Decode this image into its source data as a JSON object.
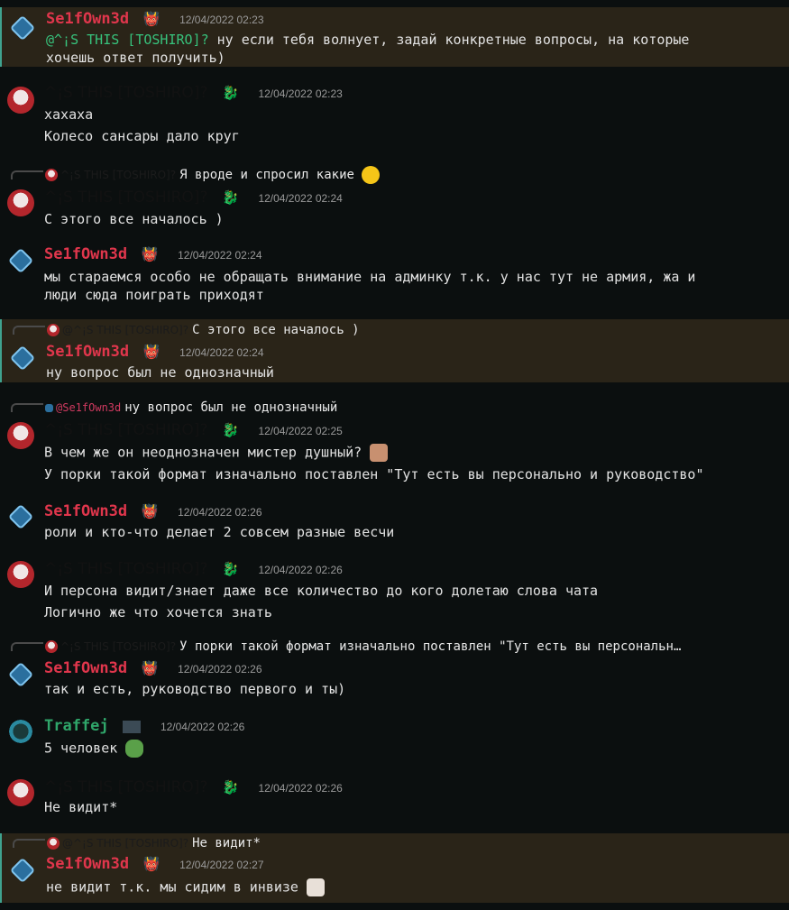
{
  "users": {
    "sel": "Se1fOwn3d",
    "toshiro": "^¡S THIS [TOSHIRO]?",
    "traffej": "Traffej"
  },
  "messages": [
    {
      "author": "Se1fOwn3d",
      "time": "12/04/2022 02:23",
      "mention": "@^¡S THIS [TOSHIRO]?",
      "lines": [
        " ну если тебя волнует, задай конкретные вопросы, на которые",
        "хочешь ответ получить)"
      ]
    },
    {
      "author": "^¡S THIS [TOSHIRO]?",
      "time": "12/04/2022 02:23",
      "lines": [
        "хахаха",
        "Колесо сансары дало круг"
      ]
    },
    {
      "reply_name": "^¡S THIS [TOSHIRO]?",
      "reply_text": "Я вроде и спросил какие",
      "author": "^¡S THIS [TOSHIRO]?",
      "time": "12/04/2022 02:24",
      "lines": [
        "С этого все началось )"
      ]
    },
    {
      "author": "Se1fOwn3d",
      "time": "12/04/2022 02:24",
      "lines": [
        "мы стараемся особо не обращать внимание на админку т.к. у нас тут не армия, жа и",
        "люди сюда поиграть приходят"
      ]
    },
    {
      "reply_name": "@^¡S THIS [TOSHIRO]?",
      "reply_text": "С этого все началось )",
      "author": "Se1fOwn3d",
      "time": "12/04/2022 02:24",
      "lines": [
        "ну вопрос был не однозначный"
      ]
    },
    {
      "reply_name": "@Se1fOwn3d",
      "reply_text": "ну вопрос был не однозначный",
      "author": "^¡S THIS [TOSHIRO]?",
      "time": "12/04/2022 02:25",
      "lines": [
        "В  чем же он неоднозначен мистер душный?",
        "У порки такой формат изначально поставлен \"Тут есть вы  персонально и руководство\""
      ]
    },
    {
      "author": "Se1fOwn3d",
      "time": "12/04/2022 02:26",
      "lines": [
        "роли и кто-что делает 2 совсем разные весчи"
      ]
    },
    {
      "author": "^¡S THIS [TOSHIRO]?",
      "time": "12/04/2022 02:26",
      "lines": [
        "И персона видит/знает даже все количество до кого долетаю слова чата",
        "Логично же что хочется знать"
      ]
    },
    {
      "reply_name": "^¡S THIS [TOSHIRO]?",
      "reply_text": "У порки такой формат изначально поставлен \"Тут есть вы  персональн…",
      "author": "Se1fOwn3d",
      "time": "12/04/2022 02:26",
      "lines": [
        "так и есть, руководство первого и ты)"
      ]
    },
    {
      "author": "Traffej",
      "time": "12/04/2022 02:26",
      "lines": [
        "5 человек"
      ]
    },
    {
      "author": "^¡S THIS [TOSHIRO]?",
      "time": "12/04/2022 02:26",
      "lines": [
        "Не видит*"
      ]
    },
    {
      "reply_name": "@^¡S THIS [TOSHIRO]?",
      "reply_text": "Не видит*",
      "author": "Se1fOwn3d",
      "time": "12/04/2022 02:27",
      "lines": [
        "не видит т.к. мы сидим в инвизе"
      ]
    }
  ]
}
